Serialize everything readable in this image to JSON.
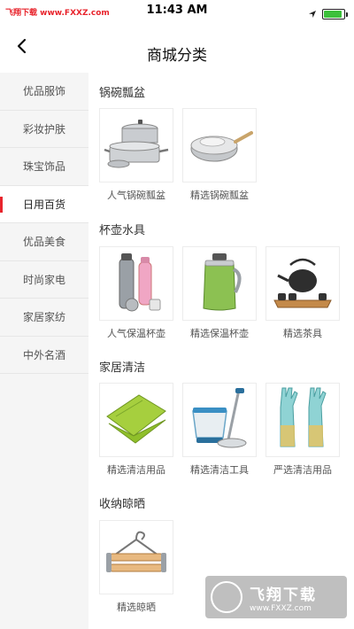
{
  "status_bar": {
    "left_text": "飞翔下载 www.FXXZ.com",
    "time": "11:43 AM",
    "battery_level": 0.9
  },
  "nav": {
    "title": "商城分类",
    "back_icon": "chevron-left-icon"
  },
  "sidebar": {
    "items": [
      {
        "label": "优品服饰"
      },
      {
        "label": "彩妆护肤"
      },
      {
        "label": "珠宝饰品"
      },
      {
        "label": "日用百货"
      },
      {
        "label": "优品美食"
      },
      {
        "label": "时尚家电"
      },
      {
        "label": "家居家纺"
      },
      {
        "label": "中外名酒"
      }
    ],
    "active_index": 3
  },
  "sections": [
    {
      "title": "锅碗瓢盆",
      "items": [
        {
          "label": "人气锅碗瓢盆",
          "icon": "cookware-set-icon"
        },
        {
          "label": "精选锅碗瓢盆",
          "icon": "wok-icon"
        }
      ]
    },
    {
      "title": "杯壶水具",
      "items": [
        {
          "label": "人气保温杯壶",
          "icon": "thermos-set-icon"
        },
        {
          "label": "精选保温杯壶",
          "icon": "vacuum-jug-icon"
        },
        {
          "label": "精选茶具",
          "icon": "tea-set-icon"
        }
      ]
    },
    {
      "title": "家居清洁",
      "items": [
        {
          "label": "精选清洁用品",
          "icon": "cleaning-cloth-icon"
        },
        {
          "label": "精选清洁工具",
          "icon": "spin-mop-icon"
        },
        {
          "label": "严选清洁用品",
          "icon": "rubber-gloves-icon"
        }
      ]
    },
    {
      "title": "收纳晾晒",
      "items": [
        {
          "label": "精选晾晒",
          "icon": "hanger-icon"
        }
      ]
    }
  ],
  "watermark": {
    "text": "飞翔下载",
    "url": "www.FXXZ.com"
  },
  "colors": {
    "accent": "#e8242c",
    "sidebar_bg": "#f5f5f5",
    "battery": "#3cc13b"
  }
}
